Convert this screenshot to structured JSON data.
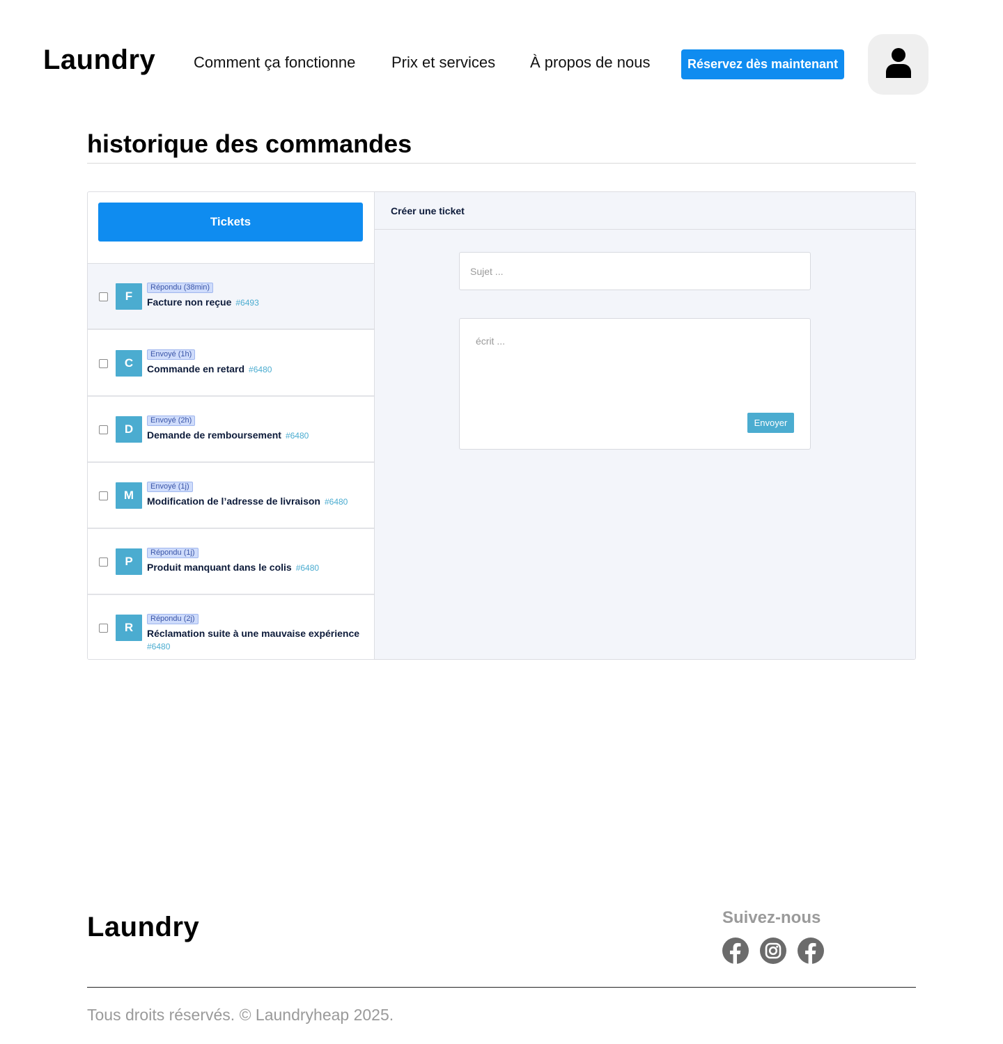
{
  "header": {
    "brand": "Laundry",
    "nav": [
      "Comment ça fonctionne",
      "Prix et services",
      "À propos de nous"
    ],
    "cta": "Réservez dès maintenant",
    "avatar_icon": "user-icon"
  },
  "page": {
    "title": "historique des commandes"
  },
  "tickets_panel": {
    "button_label": "Tickets",
    "items": [
      {
        "letter": "F",
        "badge": "Répondu (38min)",
        "title": "Facture non reçue",
        "number": "#6493",
        "checked": false,
        "active": true
      },
      {
        "letter": "C",
        "badge": "Envoyé (1h)",
        "title": "Commande en retard",
        "number": "#6480",
        "checked": false,
        "active": false
      },
      {
        "letter": "D",
        "badge": "Envoyé (2h)",
        "title": "Demande de remboursement",
        "number": "#6480",
        "checked": false,
        "active": false
      },
      {
        "letter": "M",
        "badge": "Envoyé (1j)",
        "title": "Modification de l’adresse de livraison",
        "number": "#6480",
        "checked": false,
        "active": false
      },
      {
        "letter": "P",
        "badge": "Répondu (1j)",
        "title": "Produit manquant dans le colis",
        "number": "#6480",
        "checked": false,
        "active": false
      },
      {
        "letter": "R",
        "badge": "Répondu (2j)",
        "title": "Réclamation suite à une mauvaise expérience",
        "number": "#6480",
        "checked": false,
        "active": false
      }
    ]
  },
  "create_ticket": {
    "heading": "Créer une ticket",
    "subject_placeholder": "Sujet ...",
    "subject_value": "",
    "message_placeholder": "écrit ...",
    "message_value": "",
    "send_label": "Envoyer"
  },
  "footer": {
    "brand": "Laundry",
    "follow_label": "Suivez-nous",
    "socials": [
      "facebook-icon",
      "instagram-icon",
      "facebook-icon"
    ],
    "copyright": "Tous droits réservés. © Laundryheap 2025."
  },
  "colors": {
    "primary": "#0f8cf0",
    "accent": "#4bacd0",
    "panel_bg": "#f3f5fa",
    "badge_bg": "#cfdcfb"
  }
}
